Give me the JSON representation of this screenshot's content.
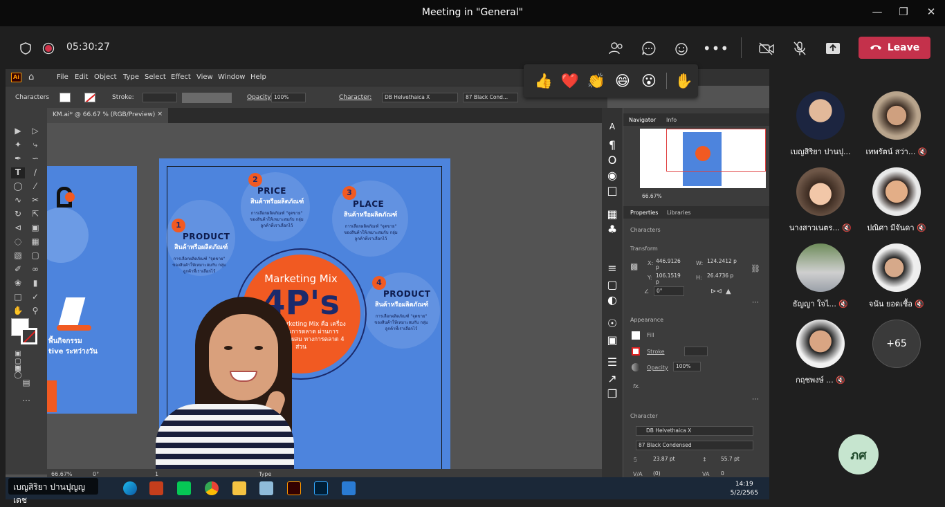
{
  "window": {
    "title": "Meeting in \"General\""
  },
  "meeting": {
    "timer": "05:30:27",
    "leave_label": "Leave"
  },
  "icons": [
    "shield-icon",
    "record-icon",
    "people-icon",
    "chat-icon",
    "reactions-icon",
    "more-icon",
    "camera-off-icon",
    "mic-off-icon",
    "share-icon",
    "phone-icon"
  ],
  "reactions": [
    "👍",
    "❤️",
    "👏",
    "😄",
    "😮",
    "✋"
  ],
  "illustrator": {
    "menus": [
      "File",
      "Edit",
      "Object",
      "Type",
      "Select",
      "Effect",
      "View",
      "Window",
      "Help"
    ],
    "control": {
      "characters": "Characters",
      "stroke": "Stroke:",
      "opacity_label": "Opacity:",
      "opacity": "100%",
      "character_label": "Character:",
      "font": "DB Helvethaica X",
      "style": "87 Black Cond..."
    },
    "doc_tab": "KM.ai* @ 66.67 % (RGB/Preview)",
    "status": {
      "zoom": "66.67%",
      "rotate": "0°",
      "artboard": "1",
      "tool": "Type"
    },
    "navigator": {
      "tabs": [
        "Navigator",
        "Info"
      ],
      "zoom": "66.67%"
    },
    "properties": {
      "tabs": [
        "Properties",
        "Libraries"
      ],
      "section": "Characters",
      "transform": "Transform",
      "x": "446.9126 p",
      "y": "106.1519 p",
      "w": "124.2412 p",
      "h": "26.4736 p",
      "angle": "0°",
      "appearance": "Appearance",
      "fill": "Fill",
      "stroke": "Stroke",
      "opacity": "Opacity",
      "opacity_value": "100%",
      "fx": "fx.",
      "character": "Character",
      "font": "DB Helvethaica X",
      "style": "87 Black Condensed",
      "size": "23.87 pt",
      "leading": "55.7 pt",
      "kerning": "(0)",
      "tracking": "0"
    }
  },
  "artwork": {
    "items": [
      {
        "num": "1",
        "head": "PRODUCT",
        "thai": "สินค้าหรือผลิตภัณฑ์",
        "body": "การเลือกผลิตภัณฑ์ \"จุดขาย\" ของสินค้าให้เหมาะสมกับ กลุ่มลูกค้าที่เราเลือกไว้"
      },
      {
        "num": "2",
        "head": "PRICE",
        "thai": "สินค้าหรือผลิตภัณฑ์",
        "body": "การเลือกผลิตภัณฑ์ \"จุดขาย\" ของสินค้าให้เหมาะสมกับ กลุ่มลูกค้าที่เราเลือกไว้"
      },
      {
        "num": "3",
        "head": "PLACE",
        "thai": "สินค้าหรือผลิตภัณฑ์",
        "body": "การเลือกผลิตภัณฑ์ \"จุดขาย\" ของสินค้าให้เหมาะสมกับ กลุ่มลูกค้าที่เราเลือกไว้"
      },
      {
        "num": "4",
        "head": "PRODUCT",
        "thai": "สินค้าหรือผลิตภัณฑ์",
        "body": "การเลือกผลิตภัณฑ์ \"จุดขาย\" ของสินค้าให้เหมาะสมกับ กลุ่มลูกค้าที่เราเลือกไว้"
      }
    ],
    "circle_title": "Marketing Mix",
    "circle_big": "4P's",
    "circle_desc": "4P หรือ Marketing Mix คือ เครื่องมือวางแผนการตลาด ผ่านการวิเคราะห์ส่วนผสม ทางการตลาด 4 ส่วน",
    "left_texts": [
      "พื้นกิจกรรม",
      "tive ระหว่างวัน"
    ]
  },
  "taskbar": {
    "time": "14:19",
    "date": "5/2/2565"
  },
  "presenter_label": "เบญสิริยา ปานปุญญเดช",
  "participants": [
    {
      "name": "เบญสิริยา ปานปุ...",
      "muted": false
    },
    {
      "name": "เทพรัตน์ สว่า...",
      "muted": true
    },
    {
      "name": "นางสาวเนตร...",
      "muted": true
    },
    {
      "name": "ปณิศา มีจันดา",
      "muted": true
    },
    {
      "name": "ธัญญา ใจไ...",
      "muted": true
    },
    {
      "name": "จนัน ยอดเชื้อ",
      "muted": true
    },
    {
      "name": "กฤชพงษ์ ...",
      "muted": true
    }
  ],
  "more_count": "+65",
  "self_initials": "ภศ"
}
